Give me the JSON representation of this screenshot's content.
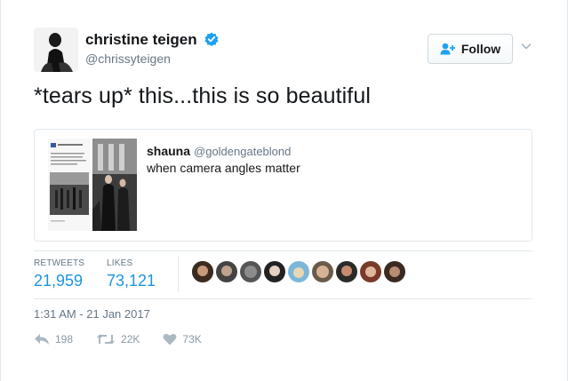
{
  "author": {
    "name": "christine teigen",
    "handle": "@chrissyteigen",
    "avatar_icon": "profile-photo",
    "verified_icon": "verified-badge-icon"
  },
  "follow_button": {
    "label": "Follow"
  },
  "tweet": {
    "text": "*tears up* this...this is so beautiful"
  },
  "quoted_tweet": {
    "name": "shauna",
    "handle": "@goldengateblond",
    "text": "when camera angles matter"
  },
  "stats": {
    "retweets_label": "RETWEETS",
    "retweets_value": "21,959",
    "likes_label": "LIKES",
    "likes_value": "73,121"
  },
  "timestamp": "1:31 AM - 21 Jan 2017",
  "actions": {
    "reply_count": "198",
    "retweet_count": "22K",
    "like_count": "73K"
  },
  "colors": {
    "accent": "#1c94e0",
    "muted": "#657786",
    "border": "#e1e8ed"
  }
}
